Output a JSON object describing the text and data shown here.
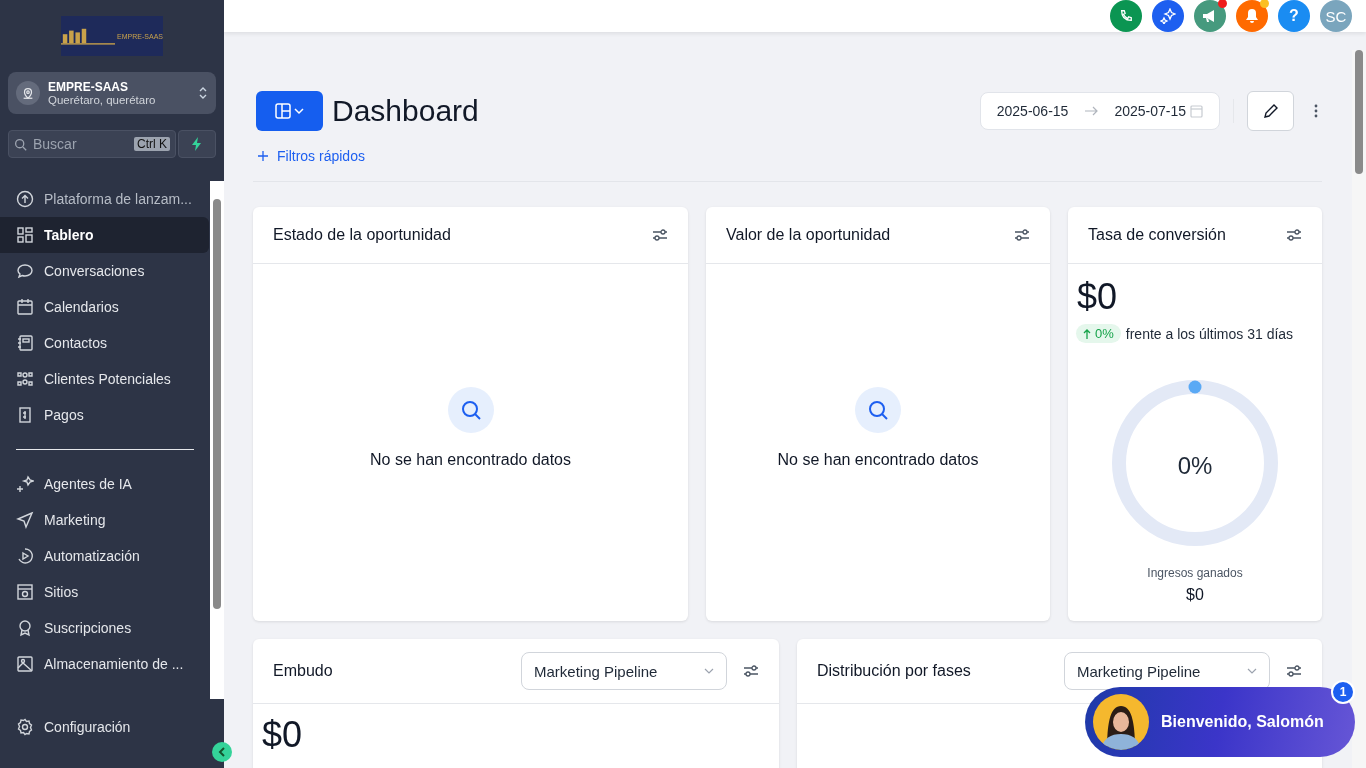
{
  "sidebar": {
    "logo_text": "EMPRE-SAAS",
    "account": {
      "name": "EMPRE-SAAS",
      "location": "Querétaro, querétaro"
    },
    "search": {
      "placeholder": "Buscar",
      "shortcut": "Ctrl K"
    },
    "items": [
      {
        "label": "Plataforma de lanzam...",
        "selected": false
      },
      {
        "label": "Tablero",
        "selected": true
      },
      {
        "label": "Conversaciones",
        "selected": false
      },
      {
        "label": "Calendarios",
        "selected": false
      },
      {
        "label": "Contactos",
        "selected": false
      },
      {
        "label": "Clientes Potenciales",
        "selected": false
      },
      {
        "label": "Pagos",
        "selected": false
      }
    ],
    "items_2": [
      {
        "label": "Agentes de IA",
        "selected": false
      },
      {
        "label": "Marketing",
        "selected": false
      },
      {
        "label": "Automatización",
        "selected": false
      },
      {
        "label": "Sitios",
        "selected": false
      },
      {
        "label": "Suscripciones",
        "selected": false
      },
      {
        "label": "Almacenamiento de ...",
        "selected": false
      }
    ],
    "settings": "Configuración"
  },
  "topbar": {
    "avatar_initials": "SC",
    "help": "?"
  },
  "header": {
    "title": "Dashboard",
    "date_from": "2025-06-15",
    "date_to": "2025-07-15",
    "quick_filters": "Filtros rápidos"
  },
  "cards": [
    {
      "title": "Estado de la oportunidad",
      "kind": "empty",
      "message": "No se han encontrado datos"
    },
    {
      "title": "Valor de la oportunidad",
      "kind": "empty",
      "message": "No se han encontrado datos"
    },
    {
      "title": "Tasa de conversión",
      "kind": "rate",
      "value": "$0",
      "change": "0%",
      "change_text": "frente a los últimos 31 días",
      "level": 0,
      "center": "0%",
      "caption": "Ingresos ganados",
      "caption_value": "$0"
    }
  ],
  "cards_2": [
    {
      "title": "Embudo",
      "select": "Marketing Pipeline",
      "value": "$0"
    },
    {
      "title": "Distribución por fases",
      "select": "Marketing Pipeline"
    }
  ],
  "chat": {
    "text": "Bienvenido, Salomón",
    "badge": "1"
  }
}
